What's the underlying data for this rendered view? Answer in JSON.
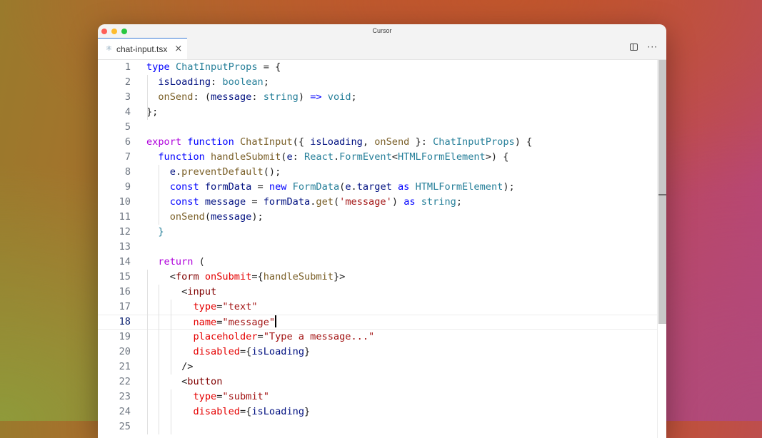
{
  "window": {
    "title": "Cursor"
  },
  "tab": {
    "filename": "chat-input.tsx",
    "close": "×",
    "more": "···"
  },
  "editor": {
    "current_line": 18,
    "lines": [
      {
        "n": "1",
        "tokens": [
          [
            "kw",
            "type"
          ],
          [
            "pun",
            " "
          ],
          [
            "ty",
            "ChatInputProps"
          ],
          [
            "pun",
            " = {"
          ]
        ]
      },
      {
        "n": "2",
        "tokens": [
          [
            "pun",
            "  "
          ],
          [
            "var",
            "isLoading"
          ],
          [
            "pun",
            ": "
          ],
          [
            "ty",
            "boolean"
          ],
          [
            "pun",
            ";"
          ]
        ]
      },
      {
        "n": "3",
        "tokens": [
          [
            "pun",
            "  "
          ],
          [
            "fn",
            "onSend"
          ],
          [
            "pun",
            ": ("
          ],
          [
            "var",
            "message"
          ],
          [
            "pun",
            ": "
          ],
          [
            "ty",
            "string"
          ],
          [
            "pun",
            ") "
          ],
          [
            "kw",
            "=>"
          ],
          [
            "pun",
            " "
          ],
          [
            "ty",
            "void"
          ],
          [
            "pun",
            ";"
          ]
        ]
      },
      {
        "n": "4",
        "tokens": [
          [
            "pun",
            "};"
          ]
        ]
      },
      {
        "n": "5",
        "tokens": []
      },
      {
        "n": "6",
        "tokens": [
          [
            "kwc",
            "export"
          ],
          [
            "pun",
            " "
          ],
          [
            "kw",
            "function"
          ],
          [
            "pun",
            " "
          ],
          [
            "fn",
            "ChatInput"
          ],
          [
            "pun",
            "({ "
          ],
          [
            "var",
            "isLoading"
          ],
          [
            "pun",
            ", "
          ],
          [
            "fn",
            "onSend"
          ],
          [
            "pun",
            " }: "
          ],
          [
            "ty",
            "ChatInputProps"
          ],
          [
            "pun",
            ") {"
          ]
        ]
      },
      {
        "n": "7",
        "tokens": [
          [
            "pun",
            "  "
          ],
          [
            "kw",
            "function"
          ],
          [
            "pun",
            " "
          ],
          [
            "fn",
            "handleSubmit"
          ],
          [
            "pun",
            "("
          ],
          [
            "var",
            "e"
          ],
          [
            "pun",
            ": "
          ],
          [
            "ty",
            "React"
          ],
          [
            "pun",
            "."
          ],
          [
            "ty",
            "FormEvent"
          ],
          [
            "pun",
            "<"
          ],
          [
            "ty",
            "HTMLFormElement"
          ],
          [
            "pun",
            ">) {"
          ]
        ]
      },
      {
        "n": "8",
        "tokens": [
          [
            "pun",
            "    "
          ],
          [
            "var",
            "e"
          ],
          [
            "pun",
            "."
          ],
          [
            "fn",
            "preventDefault"
          ],
          [
            "pun",
            "();"
          ]
        ]
      },
      {
        "n": "9",
        "tokens": [
          [
            "pun",
            "    "
          ],
          [
            "kw",
            "const"
          ],
          [
            "pun",
            " "
          ],
          [
            "var",
            "formData"
          ],
          [
            "pun",
            " = "
          ],
          [
            "kw",
            "new"
          ],
          [
            "pun",
            " "
          ],
          [
            "ty",
            "FormData"
          ],
          [
            "pun",
            "("
          ],
          [
            "var",
            "e"
          ],
          [
            "pun",
            "."
          ],
          [
            "var",
            "target"
          ],
          [
            "pun",
            " "
          ],
          [
            "kw",
            "as"
          ],
          [
            "pun",
            " "
          ],
          [
            "ty",
            "HTMLFormElement"
          ],
          [
            "pun",
            ");"
          ]
        ]
      },
      {
        "n": "10",
        "tokens": [
          [
            "pun",
            "    "
          ],
          [
            "kw",
            "const"
          ],
          [
            "pun",
            " "
          ],
          [
            "var",
            "message"
          ],
          [
            "pun",
            " = "
          ],
          [
            "var",
            "formData"
          ],
          [
            "pun",
            "."
          ],
          [
            "fn",
            "get"
          ],
          [
            "pun",
            "("
          ],
          [
            "str",
            "'message'"
          ],
          [
            "pun",
            ") "
          ],
          [
            "kw",
            "as"
          ],
          [
            "pun",
            " "
          ],
          [
            "ty",
            "string"
          ],
          [
            "pun",
            ";"
          ]
        ]
      },
      {
        "n": "11",
        "tokens": [
          [
            "pun",
            "    "
          ],
          [
            "fn",
            "onSend"
          ],
          [
            "pun",
            "("
          ],
          [
            "var",
            "message"
          ],
          [
            "pun",
            ");"
          ]
        ]
      },
      {
        "n": "12",
        "tokens": [
          [
            "pun",
            "  "
          ],
          [
            "ty",
            "}"
          ]
        ]
      },
      {
        "n": "13",
        "tokens": []
      },
      {
        "n": "14",
        "tokens": [
          [
            "pun",
            "  "
          ],
          [
            "kwc",
            "return"
          ],
          [
            "pun",
            " ("
          ]
        ]
      },
      {
        "n": "15",
        "tokens": [
          [
            "pun",
            "    <"
          ],
          [
            "tag",
            "form"
          ],
          [
            "pun",
            " "
          ],
          [
            "attr",
            "onSubmit"
          ],
          [
            "pun",
            "={"
          ],
          [
            "fn",
            "handleSubmit"
          ],
          [
            "pun",
            "}>"
          ]
        ]
      },
      {
        "n": "16",
        "tokens": [
          [
            "pun",
            "      <"
          ],
          [
            "tag",
            "input"
          ]
        ]
      },
      {
        "n": "17",
        "tokens": [
          [
            "pun",
            "        "
          ],
          [
            "attr",
            "type"
          ],
          [
            "pun",
            "="
          ],
          [
            "str",
            "\"text\""
          ]
        ]
      },
      {
        "n": "18",
        "tokens": [
          [
            "pun",
            "        "
          ],
          [
            "attr",
            "name"
          ],
          [
            "pun",
            "="
          ],
          [
            "str",
            "\"message\""
          ]
        ]
      },
      {
        "n": "19",
        "tokens": [
          [
            "pun",
            "        "
          ],
          [
            "attr",
            "placeholder"
          ],
          [
            "pun",
            "="
          ],
          [
            "str",
            "\"Type a message...\""
          ]
        ]
      },
      {
        "n": "20",
        "tokens": [
          [
            "pun",
            "        "
          ],
          [
            "attr",
            "disabled"
          ],
          [
            "pun",
            "={"
          ],
          [
            "var",
            "isLoading"
          ],
          [
            "pun",
            "}"
          ]
        ]
      },
      {
        "n": "21",
        "tokens": [
          [
            "pun",
            "      />"
          ]
        ]
      },
      {
        "n": "22",
        "tokens": [
          [
            "pun",
            "      <"
          ],
          [
            "tag",
            "button"
          ]
        ]
      },
      {
        "n": "23",
        "tokens": [
          [
            "pun",
            "        "
          ],
          [
            "attr",
            "type"
          ],
          [
            "pun",
            "="
          ],
          [
            "str",
            "\"submit\""
          ]
        ]
      },
      {
        "n": "24",
        "tokens": [
          [
            "pun",
            "        "
          ],
          [
            "attr",
            "disabled"
          ],
          [
            "pun",
            "={"
          ],
          [
            "var",
            "isLoading"
          ],
          [
            "pun",
            "}"
          ]
        ]
      },
      {
        "n": "25",
        "tokens": []
      }
    ]
  }
}
